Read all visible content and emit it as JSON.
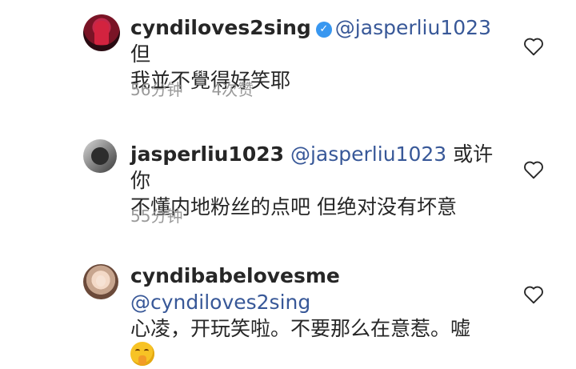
{
  "comments": [
    {
      "username": "cyndiloves2sing",
      "verified": true,
      "mention": "@jasperliu1023",
      "text_line1_suffix": "但",
      "text_line2": "我並不覺得好笑耶",
      "time": "56分钟",
      "likes": "4次赞",
      "avatar": "avatar-red-figure"
    },
    {
      "username": "jasperliu1023",
      "verified": false,
      "mention": "@jasperliu1023",
      "text_line1_suffix": "或许你",
      "text_line2": "不懂内地粉丝的点吧 但绝对没有坏意",
      "time": "55分钟",
      "avatar": "avatar-gray"
    },
    {
      "username": "cyndibabelovesme",
      "verified": false,
      "mention": "@cyndiloves2sing",
      "text_line2": "心凌，开玩笑啦。不要那么在意惹。嘘",
      "emoji": "shushing-face-icon",
      "avatar": "avatar-face"
    }
  ],
  "colors": {
    "mention": "#385898",
    "meta": "#999999",
    "verified": "#3897f0"
  }
}
